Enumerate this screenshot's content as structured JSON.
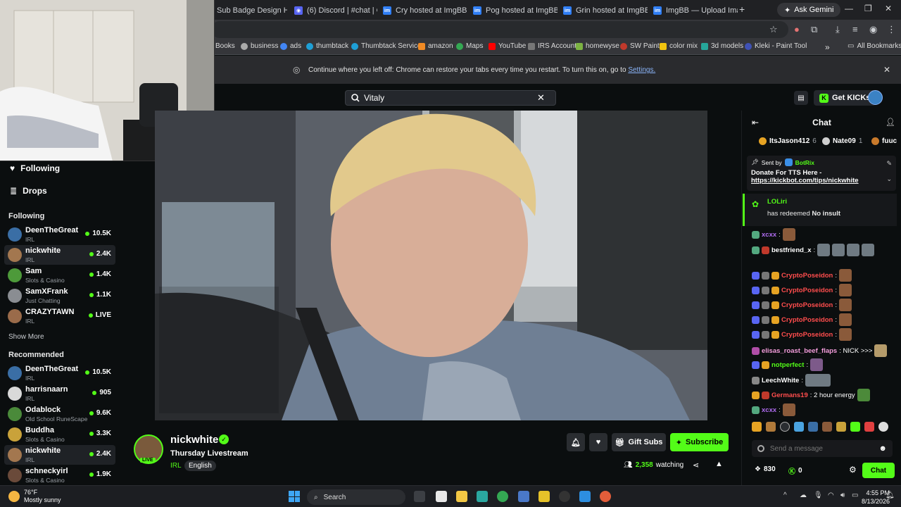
{
  "browser": {
    "tabs": [
      {
        "label": "Sub Badge Design Hel"
      },
      {
        "label": "(6) Discord | #chat | G"
      },
      {
        "label": "Cry hosted at ImgBB"
      },
      {
        "label": "Pog hosted at ImgBB"
      },
      {
        "label": "Grin hosted at ImgBB"
      },
      {
        "label": "ImgBB — Upload Imag"
      }
    ],
    "ask_gemini": "Ask Gemini",
    "bookmarks": [
      "Books",
      "business",
      "ads",
      "thumbtack",
      "Thumbtack Services",
      "amazon",
      "Maps",
      "YouTube",
      "IRS Account",
      "homewyse",
      "SW Paint",
      "color mix",
      "3d models",
      "Kleki - Paint Tool"
    ],
    "all_bookmarks": "All Bookmarks",
    "restore_text": "Continue where you left off: Chrome can restore your tabs every time you restart. To turn this on, go to",
    "restore_link": "Settings."
  },
  "kick": {
    "search_value": "Vitaly",
    "get_kicks": "Get KICKs"
  },
  "sidebar": {
    "nav": [
      {
        "label": "Following"
      },
      {
        "label": "Drops"
      }
    ],
    "following_header": "Following",
    "following": [
      {
        "name": "DeenTheGreat",
        "category": "IRL",
        "viewers": "10.5K",
        "color": "#3a6ea5"
      },
      {
        "name": "nickwhite",
        "category": "IRL",
        "viewers": "2.4K",
        "color": "#a3774f"
      },
      {
        "name": "Sam",
        "category": "Slots & Casino",
        "viewers": "1.4K",
        "color": "#4d9a3a"
      },
      {
        "name": "SamXFrank",
        "category": "Just Chatting",
        "viewers": "1.1K",
        "color": "#8a8d92"
      },
      {
        "name": "CRAZYTAWN",
        "category": "IRL",
        "viewers": "LIVE",
        "color": "#9a6b4a"
      }
    ],
    "show_more": "Show More",
    "recommended_header": "Recommended",
    "recommended": [
      {
        "name": "DeenTheGreat",
        "category": "IRL",
        "viewers": "10.5K",
        "color": "#3a6ea5"
      },
      {
        "name": "harrisnaarn",
        "category": "IRL",
        "viewers": "905",
        "color": "#d9d9d9"
      },
      {
        "name": "Odablock",
        "category": "Old School RuneScape",
        "viewers": "9.6K",
        "color": "#4a8a3a"
      },
      {
        "name": "Buddha",
        "category": "Slots & Casino",
        "viewers": "3.3K",
        "color": "#c9a23a"
      },
      {
        "name": "nickwhite",
        "category": "IRL",
        "viewers": "2.4K",
        "color": "#a3774f"
      },
      {
        "name": "schneckyirl",
        "category": "Slots & Casino",
        "viewers": "1.9K",
        "color": "#6a4a3a"
      }
    ]
  },
  "channel": {
    "name": "nickwhite",
    "title": "Thursday Livestream",
    "category": "IRL",
    "language": "English",
    "live": "LIVE",
    "gift_subs": "Gift Subs",
    "subscribe": "Subscribe",
    "watching_count": "2,358",
    "watching_label": "watching"
  },
  "chat": {
    "title": "Chat",
    "top_gifters": [
      {
        "name": "ItsJason412",
        "count": "6"
      },
      {
        "name": "Nate09",
        "count": "1"
      },
      {
        "name": "fuuc",
        "count": ""
      }
    ],
    "pinned": {
      "sent_by": "Sent by",
      "bot": "BotRix",
      "message": "Donate For TTS Here -",
      "link": "https://kickbot.com/tips/nickwhite"
    },
    "redeem": {
      "user": "LOLiri",
      "text": "has redeemed",
      "reward": "No insult"
    },
    "messages": [
      {
        "user": "xcxx",
        "color": "#b06cf0",
        "text": ""
      },
      {
        "user": "bestfriend_x",
        "color": "#ffffff",
        "text": ""
      },
      {
        "user": "CryptoPoseidon",
        "color": "#ff4d4d",
        "text": ""
      },
      {
        "user": "CryptoPoseidon",
        "color": "#ff4d4d",
        "text": ""
      },
      {
        "user": "CryptoPoseidon",
        "color": "#ff4d4d",
        "text": ""
      },
      {
        "user": "CryptoPoseidon",
        "color": "#ff4d4d",
        "text": ""
      },
      {
        "user": "CryptoPoseidon",
        "color": "#ff4d4d",
        "text": ""
      },
      {
        "user": "elisas_roast_beef_flaps",
        "color": "#f49ddc",
        "text": ": NICK >>>"
      },
      {
        "user": "notperfect",
        "color": "#53fc18",
        "text": ""
      },
      {
        "user": "LeechWhite",
        "color": "#ffffff",
        "text": ""
      },
      {
        "user": "Germans19",
        "color": "#ff4d4d",
        "text": ": 2 hour energy"
      },
      {
        "user": "xcxx",
        "color": "#b06cf0",
        "text": ""
      }
    ],
    "input_placeholder": "Send a message",
    "kicks_balance": "830",
    "points": "0",
    "chat_button": "Chat"
  },
  "taskbar": {
    "weather_temp": "76°F",
    "weather_desc": "Mostly sunny",
    "search": "Search",
    "time": "4:55 PM",
    "date": "8/13/2026"
  },
  "colors": {
    "kick_green": "#53fc18",
    "bg": "#0b0e0f"
  }
}
